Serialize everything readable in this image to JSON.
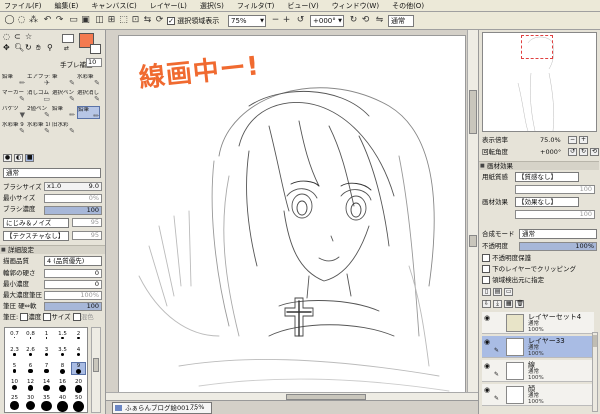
{
  "menu": [
    "ファイル(F)",
    "編集(E)",
    "キャンバス(C)",
    "レイヤー(L)",
    "選択(S)",
    "フィルタ(T)",
    "ビュー(V)",
    "ウィンドウ(W)",
    "その他(O)"
  ],
  "toolbar": {
    "show_selection_label": "選択領域表示",
    "zoom_value": "75%",
    "rotation_value": "+000°",
    "blend_value": "通常",
    "stabilizer_label": "手ブレ補正",
    "stabilizer_value": "10"
  },
  "colors": {
    "foreground": "#f47a50",
    "background": "#ffffff",
    "annotation": "#f06a30",
    "selection": "#a9bce4"
  },
  "tools": [
    {
      "name": "鉛筆",
      "glyph": "✏"
    },
    {
      "name": "エアブラシ",
      "glyph": "✈"
    },
    {
      "name": "筆",
      "glyph": "✎"
    },
    {
      "name": "水彩筆",
      "glyph": "✎"
    },
    {
      "name": "マーカー",
      "glyph": "✎"
    },
    {
      "name": "消しゴム",
      "glyph": "▭"
    },
    {
      "name": "選択ペン",
      "glyph": "✎"
    },
    {
      "name": "選択消し",
      "glyph": "✎"
    },
    {
      "name": "バケツ",
      "glyph": "▼"
    },
    {
      "name": "2値ペン",
      "glyph": "✎"
    },
    {
      "name": "鉛筆",
      "glyph": "✏"
    },
    {
      "name": "鉛筆",
      "glyph": "✏"
    },
    {
      "name": "水彩筆 9",
      "glyph": "✎"
    },
    {
      "name": "水彩筆 10",
      "glyph": "✎"
    },
    {
      "name": "旧水彩",
      "glyph": "✎"
    }
  ],
  "brush": {
    "mode": "通常",
    "size_label": "ブラシサイズ",
    "size_mult": "x1.0",
    "size_value": "9.0",
    "min_size_label": "最小サイズ",
    "min_size_value": "0%",
    "density_label": "ブラシ濃度",
    "density_value": "100",
    "texture1": "にじみ＆ノイズ",
    "texture1_value": "95",
    "texture2": "【テクスチャなし】",
    "texture2_value": "95"
  },
  "detail": {
    "header": "詳細設定",
    "quality_label": "描画品質",
    "quality_value": "4 (品質優先)",
    "edge_label": "輪郭の硬さ",
    "edge_value": "0",
    "min_density_label": "最小濃度",
    "min_density_value": "0",
    "max_pressure_label": "最大濃度筆圧",
    "max_pressure_value": "100%",
    "hardsoft_label": "筆圧 硬⇔軟",
    "hardsoft_value": "100",
    "pressure_label": "筆圧:",
    "pressure_opts": [
      "濃度",
      "サイズ",
      "混色"
    ]
  },
  "brush_sizes": [
    [
      "0.7",
      "0.8",
      "1",
      "1.5",
      "2"
    ],
    [
      "2.3",
      "2.6",
      "3",
      "3.5",
      "4"
    ],
    [
      "5",
      "6",
      "7",
      "8",
      "9"
    ],
    [
      "10",
      "12",
      "14",
      "16",
      "20"
    ],
    [
      "25",
      "30",
      "35",
      "40",
      "50"
    ]
  ],
  "navigator": {
    "zoom_label": "表示倍率",
    "zoom_value": "75.0%",
    "angle_label": "回転角度",
    "angle_value": "+000°"
  },
  "paper": {
    "header": "画材効果",
    "texture_label": "用紙質感",
    "texture_value": "【質感なし】",
    "effect_label": "画材効果",
    "effect_value": "【効果なし】",
    "texture_num": "100",
    "effect_num": "100"
  },
  "layer_panel": {
    "blend_label": "合成モード",
    "blend_value": "通常",
    "opacity_label": "不透明度",
    "opacity_value": "100%",
    "protect_label": "不透明度保護",
    "clip_label": "下のレイヤーでクリッピング",
    "source_label": "領域検出元に指定"
  },
  "layers": [
    {
      "name": "レイヤーセット4",
      "mode": "通常",
      "opacity": "100%",
      "selected": false,
      "folder": true
    },
    {
      "name": "レイヤー33",
      "mode": "通常",
      "opacity": "100%",
      "selected": true,
      "folder": false
    },
    {
      "name": "線",
      "mode": "通常",
      "opacity": "100%",
      "selected": false,
      "folder": false
    },
    {
      "name": "顔",
      "mode": "通常",
      "opacity": "100%",
      "selected": false,
      "folder": false
    }
  ],
  "canvas": {
    "annotation_text": "線画中ー!"
  },
  "document": {
    "name": "ふぁらんブログ絵001....",
    "zoom": "75%"
  }
}
